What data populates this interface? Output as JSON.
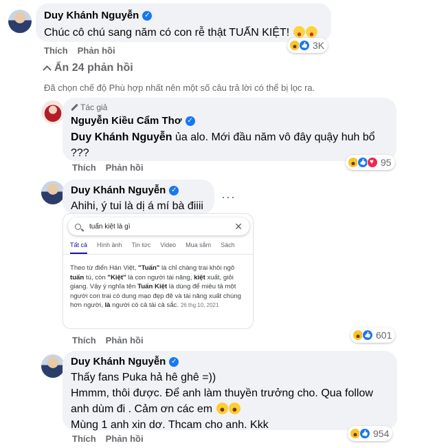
{
  "comments": [
    {
      "author": "Duy Khánh Nguyễn",
      "text": "Chúc cô chú sang năm có con rễ thật TUẤN KIỆT!",
      "like_label": "Thích",
      "reply_label": "Phản hồi",
      "reaction_count": "3K"
    }
  ],
  "replies_toggle": "Ẩn 24 phản hồi",
  "filter_note": "Đã chọn chế độ Phù hợp nhất nên một số câu trả lời có thể bị lọc ra.",
  "replies": [
    {
      "author_tag": "Tác giả",
      "author": "Nguyễn Kiều Cẩm Thơ",
      "mention": "Duy Khánh Nguyễn",
      "text": " ủa alo. Mới đầu năm vô đây quậy huh bổ",
      "text_line2": "???",
      "like_label": "Thích",
      "reply_label": "Phản hồi",
      "reaction_count": "95"
    },
    {
      "author": "Duy Khánh Nguyễn",
      "text": "Ahihi, ý tui là dị á mí bà điiii",
      "like_label": "Thích",
      "reply_label": "Phản hồi",
      "reaction_count": "601",
      "more": "···"
    },
    {
      "author": "Duy Khánh Nguyễn",
      "line1": "Thấy fans Puka hả hê ghê =))",
      "line2": "Hmmm, thôi được. Để anh làm thuyền trưởng cho. Qua follow",
      "line3": "anh dùm đi . Cảm ơn các em",
      "line4": "Mùng 1 anh xin dơ. Thcam cho anh. Kkk",
      "like_label": "Thích",
      "reply_label": "Phản hồi",
      "reaction_count": "954"
    }
  ],
  "search_screenshot": {
    "query": "tuấn kiệt là gì",
    "close": "✕",
    "tabs": [
      "Tất cả",
      "Hình ảnh",
      "Tin tức",
      "Video",
      "Mua sắm",
      "Sách"
    ],
    "body_p1": "Theo từ điển Hán Việt, ",
    "body_q1": "\"Tuấn\"",
    "body_p2": " là chỉ chàng trai khôi ngô ",
    "body_b1": "tuấn",
    "body_p3": " tú, còn ",
    "body_q2": "\"Kiệt\"",
    "body_p4": " là con người tài năng, ",
    "body_b2": "kiệt",
    "body_p5": " xuất, giỏi giang. Vậy ý nghĩa tên ",
    "body_b3": "Tuấn Kiệt",
    "body_p6": " là dùng để miêu tả một người con trai có dung mạo đẹp đẽ và tài năng xuất chúng hơn người, ",
    "body_b4": "là",
    "body_p7": " người có cả tài cả sắc. ",
    "date": "26 thg 10, 2021"
  },
  "colors": {
    "bubble": "#f0f2f5",
    "secondary_text": "#65676b",
    "verified": "#1877f2"
  }
}
